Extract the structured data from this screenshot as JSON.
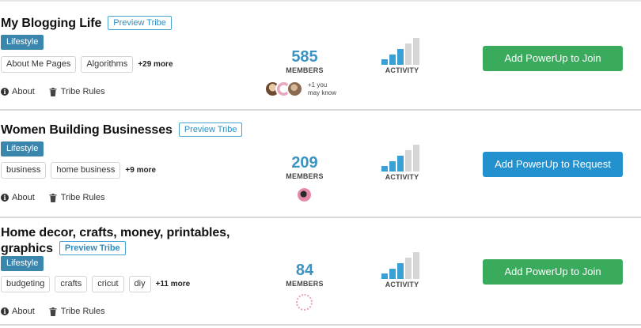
{
  "tribes": [
    {
      "title": "My Blogging Life",
      "preview_label": "Preview Tribe",
      "category": "Lifestyle",
      "tags": [
        "About Me Pages",
        "Algorithms"
      ],
      "more_tags": "+29 more",
      "about_label": "About",
      "rules_label": "Tribe Rules",
      "members_count": "585",
      "members_label": "MEMBERS",
      "mutual_line1": "+1 you",
      "mutual_line2": "may know",
      "activity_label": "ACTIVITY",
      "activity_level": 0.6,
      "action_label": "Add PowerUp to Join",
      "action_color": "#3aaa5c"
    },
    {
      "title": "Women Building Businesses",
      "preview_label": "Preview Tribe",
      "category": "Lifestyle",
      "tags": [
        "business",
        "home business"
      ],
      "more_tags": "+9 more",
      "about_label": "About",
      "rules_label": "Tribe Rules",
      "members_count": "209",
      "members_label": "MEMBERS",
      "activity_label": "ACTIVITY",
      "activity_level": 0.6,
      "action_label": "Add PowerUp to Request",
      "action_color": "#2491cf"
    },
    {
      "title_line1": "Home decor, crafts, money, printables,",
      "title_line2": "graphics",
      "preview_label": "Preview Tribe",
      "category": "Lifestyle",
      "tags": [
        "budgeting",
        "crafts",
        "cricut",
        "diy"
      ],
      "more_tags": "+11 more",
      "about_label": "About",
      "rules_label": "Tribe Rules",
      "members_count": "84",
      "members_label": "MEMBERS",
      "activity_label": "ACTIVITY",
      "activity_level": 0.6,
      "action_label": "Add PowerUp to Join",
      "action_color": "#3aaa5c"
    }
  ],
  "colors": {
    "accent_blue": "#3a93c2",
    "category_bg": "#3a86ad",
    "bar_active": "#3aa0d4",
    "bar_inactive": "#d6d6d6"
  },
  "icons": {
    "about": "info-icon",
    "rules": "trash-icon"
  }
}
